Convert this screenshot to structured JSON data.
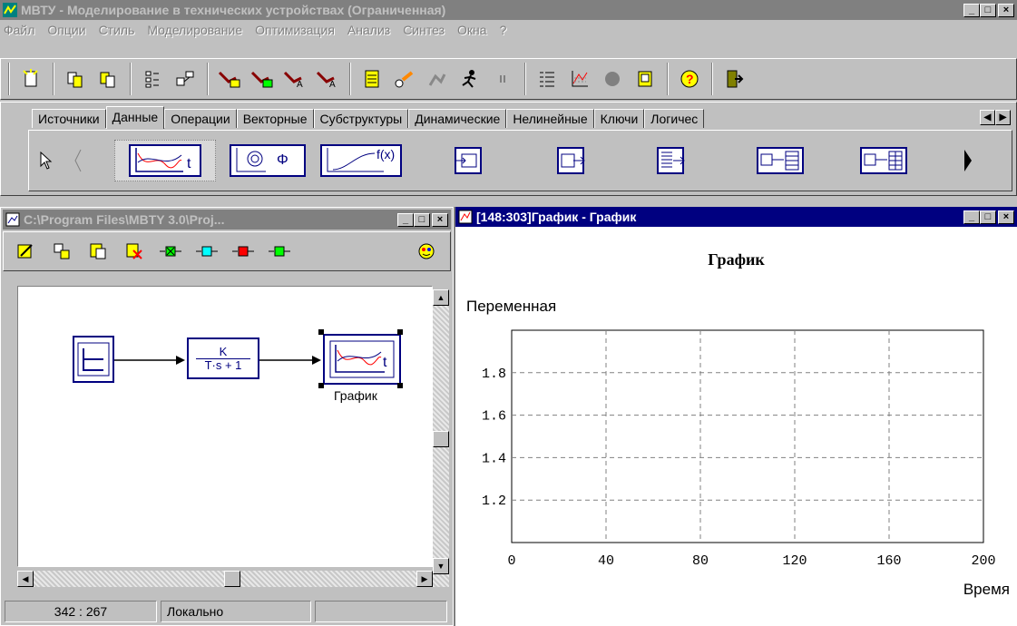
{
  "app": {
    "title": "МВТУ - Моделирование в технических устройствах (Ограниченная)",
    "menu": [
      "Файл",
      "Опции",
      "Стиль",
      "Моделирование",
      "Оптимизация",
      "Анализ",
      "Синтез",
      "Окна",
      "?"
    ]
  },
  "toolbar": {
    "icons": [
      "new-icon",
      "open-icon",
      "save-icon",
      "list-icon",
      "tree-icon",
      "block-icon-1",
      "block-icon-2",
      "block-icon-3",
      "block-icon-4",
      "document-icon",
      "run-icon",
      "step-icon",
      "runner-icon",
      "pause-icon",
      "params-icon",
      "graph-icon",
      "stop-icon",
      "print-icon",
      "help-icon",
      "exit-icon"
    ]
  },
  "palette": {
    "tabs": [
      "Источники",
      "Данные",
      "Операции",
      "Векторные",
      "Субструктуры",
      "Динамические",
      "Нелинейные",
      "Ключи",
      "Логичес"
    ],
    "active_tab": "Данные"
  },
  "model_window": {
    "title": "C:\\Program Files\\MBTY 3.0\\Proj...",
    "blocks": {
      "tf_numerator": "K",
      "tf_denominator": "T·s + 1",
      "graph_label": "График"
    },
    "status": {
      "coords": "342 : 267",
      "mode": "Локально"
    }
  },
  "graph_window": {
    "title": "[148:303]График - График"
  },
  "chart_data": {
    "type": "line",
    "title": "График",
    "xlabel": "Время",
    "ylabel": "Переменная",
    "xlim": [
      0,
      200
    ],
    "ylim": [
      1.0,
      2.0
    ],
    "xticks": [
      "0",
      "40",
      "80",
      "120",
      "160",
      "200"
    ],
    "yticks": [
      "1.2",
      "1.4",
      "1.6",
      "1.8"
    ],
    "grid": true,
    "series": []
  },
  "colors": {
    "active_title": "#000080",
    "inactive_title": "#808080",
    "face": "#c0c0c0"
  }
}
